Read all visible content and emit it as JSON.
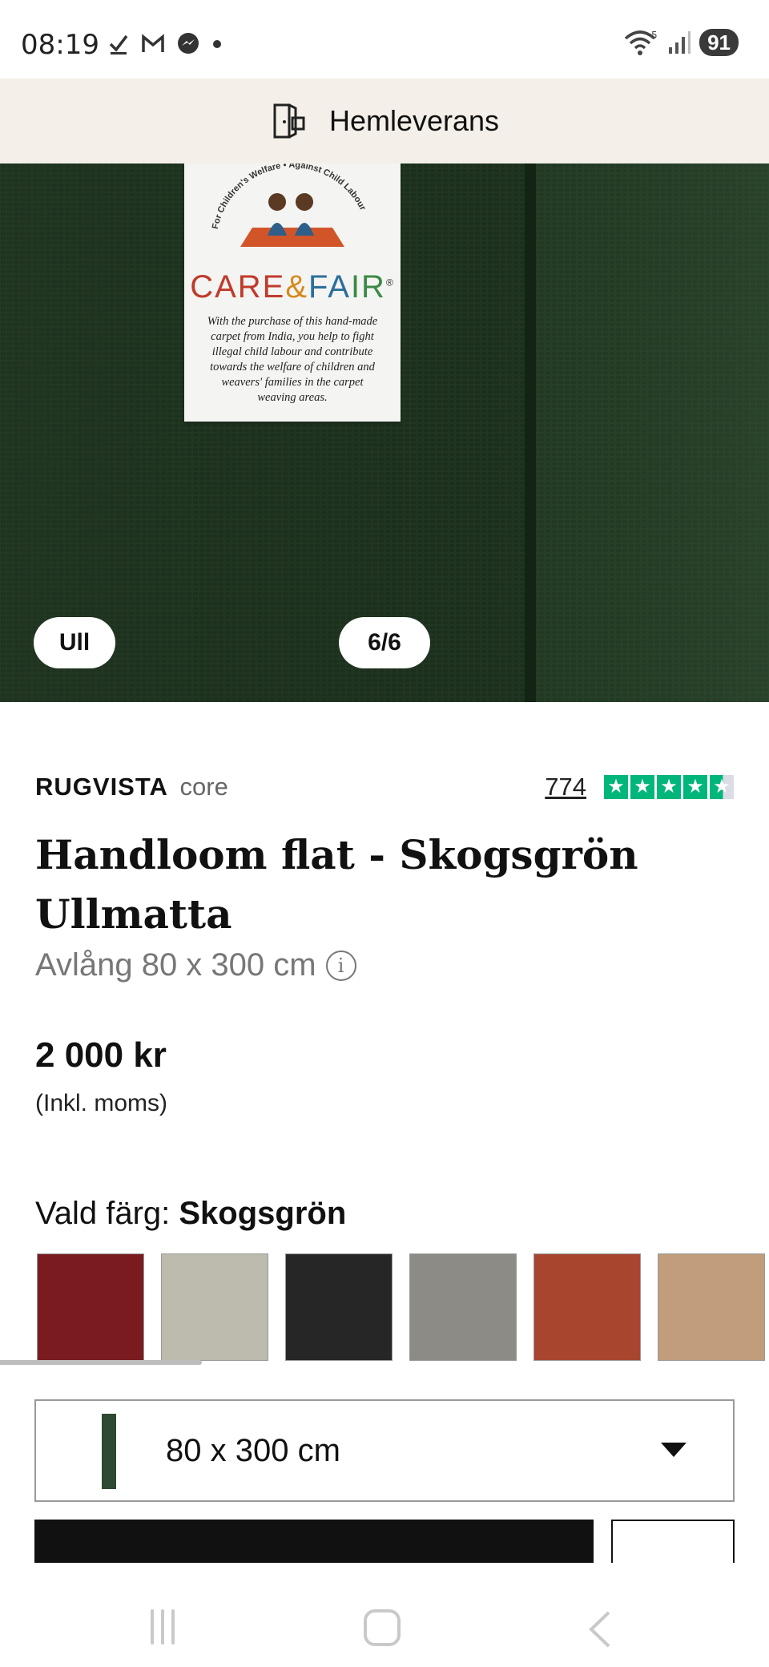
{
  "status_bar": {
    "time": "08:19",
    "left_icons": [
      "check-icon",
      "gmail-icon",
      "messenger-icon",
      "dot-icon"
    ],
    "right_icons": [
      "wifi-icon",
      "signal-icon"
    ],
    "battery": "91"
  },
  "delivery": {
    "icon": "door-delivery-icon",
    "label": "Hemleverans"
  },
  "gallery": {
    "material_badge": "Ull",
    "counter": "6/6",
    "care_label": {
      "arc_text": "For Children's Welfare • Against Child Labour",
      "brand": [
        "CARE",
        "&",
        "FA",
        "IR"
      ],
      "registered": "®",
      "text": "With the purchase of this hand-made carpet from India, you help to fight illegal child labour and contribute towards the welfare of children and weavers' families in the carpet weaving areas."
    }
  },
  "product": {
    "brand": "RUGVISTA",
    "line": "core",
    "review_count": "774",
    "rating_stars": 4.5,
    "title": "Handloom flat - Skogsgrön Ullmatta",
    "shape_size": "Avlång 80 x 300 cm",
    "price": "2 000 kr",
    "vat_note": "(Inkl. moms)"
  },
  "color": {
    "label": "Vald färg:",
    "selected": "Skogsgrön",
    "swatches": [
      "#7a1c1f",
      "#bdbaae",
      "#262626",
      "#8c8b85",
      "#a8452f",
      "#c19d7b"
    ]
  },
  "size_select": {
    "value": "80 x 300 cm",
    "thumb_color": "#2f4a33"
  },
  "colors": {
    "accent_trustpilot": "#00b67a",
    "hero_green": "#213322",
    "banner_bg": "#f4efe8"
  }
}
